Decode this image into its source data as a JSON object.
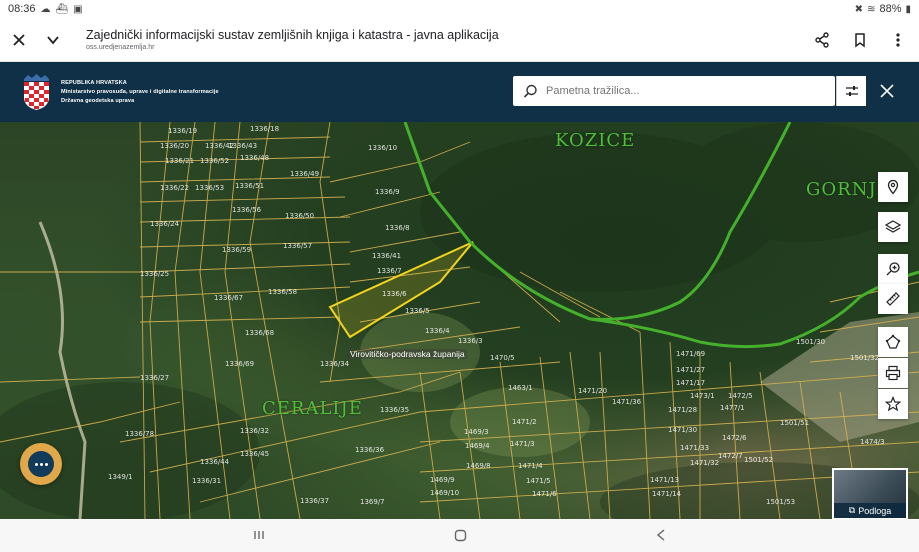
{
  "status_bar": {
    "time": "08:36",
    "battery": "88%"
  },
  "browser": {
    "title": "Zajednički informacijski sustav zemljišnih knjiga i katastra - javna aplikacija",
    "url": "oss.uredjenazemlja.hr"
  },
  "header": {
    "org_line1": "REPUBLIKA HRVATSKA",
    "org_line2": "Ministarstvo pravosuđa, uprave i digitalne transformacije",
    "org_line3": "Državna geodetska uprava",
    "search_placeholder": "Pametna tražilica..."
  },
  "map": {
    "place_names": [
      "KOZICE",
      "GORNJ",
      "CERALIJE"
    ],
    "county_label": "Virovitičko-podravska županija",
    "parcels": [
      "1336/19",
      "1336/18",
      "1336/20",
      "1336/42",
      "1336/43",
      "1336/21",
      "1336/52",
      "1336/48",
      "1336/10",
      "1336/49",
      "1336/22",
      "1336/53",
      "1336/51",
      "1336/9",
      "1336/24",
      "1336/50",
      "1336/56",
      "1336/8",
      "1336/59",
      "1336/57",
      "1336/41",
      "1336/7",
      "1336/25",
      "1336/58",
      "1336/67",
      "1336/6",
      "1336/5",
      "1336/68",
      "1336/4",
      "1336/3",
      "1336/69",
      "1336/34",
      "1336/27",
      "1336/35",
      "1336/32",
      "1336/78",
      "1336/36",
      "1336/45",
      "1336/44",
      "1336/31",
      "1349/1",
      "1336/37",
      "1369/7",
      "1470/5",
      "1471/20",
      "1471/69",
      "1471/36",
      "1471/28",
      "1471/30",
      "1471/33",
      "1471/32",
      "1501/52",
      "1501/53",
      "1501/51",
      "1501/30",
      "1501/32",
      "1474/3",
      "1463/1",
      "1469/3",
      "1469/4",
      "1469/8",
      "1469/9",
      "1469/10",
      "1471/2",
      "1471/3",
      "1471/4",
      "1471/5",
      "1471/6",
      "1471/17",
      "1472/5",
      "1472/6",
      "1472/7",
      "1471/13",
      "1471/14",
      "1477/1",
      "1471/27",
      "1473/1"
    ]
  },
  "basemap_label": "Podloga"
}
